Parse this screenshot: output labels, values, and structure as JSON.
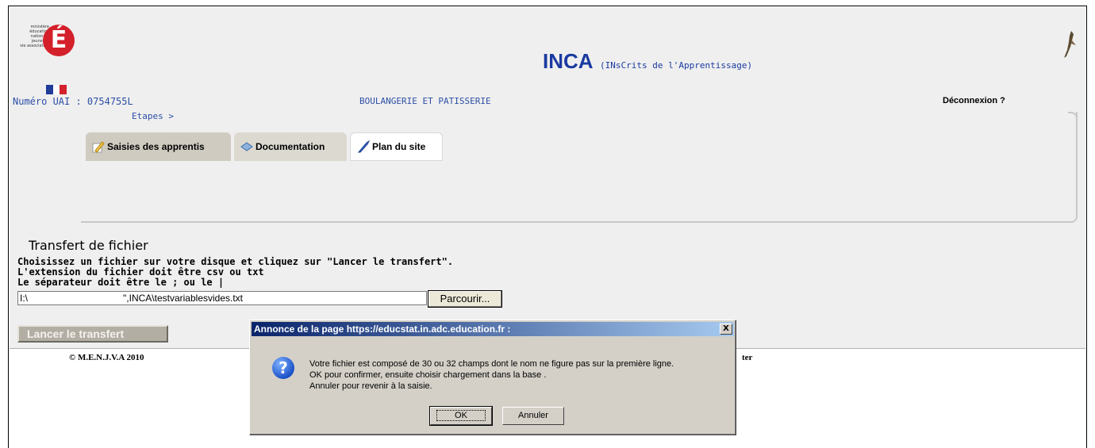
{
  "logo": {
    "ministry_lines": [
      "ministère",
      "éducation",
      "nationale",
      "jeunesse",
      "vie associative"
    ],
    "letter": "É",
    "flag_colors": [
      "#1f3d99",
      "#ffffff",
      "#d4202a"
    ]
  },
  "header": {
    "uai_label": "Numéro UAI : 0754755L",
    "etablissement": "BOULANGERIE ET PATISSERIE",
    "logout": "Déconnexion ?",
    "steps": "Etapes >",
    "app_title": "INCA",
    "app_subtitle": "(INsCrits de l'Apprentissage)"
  },
  "tabs": [
    {
      "label": "Saisies des apprentis",
      "icon": "pencil-icon"
    },
    {
      "label": "Documentation",
      "icon": "book-icon"
    },
    {
      "label": "Plan du site",
      "icon": "quill-icon"
    }
  ],
  "transfer": {
    "title": "Transfert de fichier",
    "instruction1": "Choisissez un fichier sur votre disque et cliquez sur \"Lancer le transfert\".",
    "instruction2": "L'extension du fichier doit être csv ou txt",
    "instruction3": "Le séparateur doit être le ; ou le |",
    "file_value": "I:\\                                    \",INCA\\testvariablesvides.txt",
    "browse_label": "Parcourir...",
    "launch_label": "Lancer le transfert"
  },
  "footer": {
    "copyright": "© M.E.N.J.V.A 2010",
    "right_fragment": "ter"
  },
  "dialog": {
    "title": "Annonce de la page https://educstat.in.adc.education.fr :",
    "close": "X",
    "icon": "question-icon",
    "message_lines": [
      "Votre fichier est composé de 30 ou 32 champs dont le nom ne figure pas sur la première ligne.",
      "OK pour confirmer, ensuite choisir chargement dans la base .",
      "Annuler pour revenir à la saisie."
    ],
    "ok_label": "OK",
    "cancel_label": "Annuler"
  },
  "colors": {
    "accent_blue": "#1a3aa0",
    "link_blue": "#2c4fa6",
    "page_bg": "#efefef",
    "dialog_bg": "#d4d0c8"
  }
}
